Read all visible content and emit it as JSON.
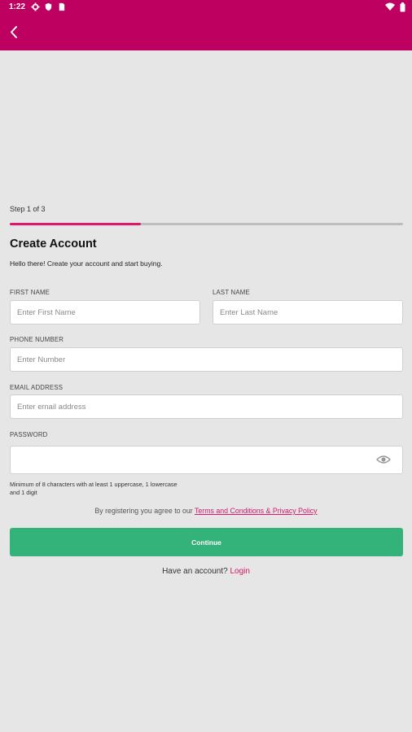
{
  "status_bar": {
    "time": "1:22",
    "icons": [
      "gear-icon",
      "shield-icon",
      "sim-card-icon",
      "wifi-icon",
      "battery-icon"
    ]
  },
  "app_bar": {
    "back_icon": "back-arrow-icon",
    "color": "#be0060"
  },
  "progress": {
    "step_label": "Step 1 of 3",
    "fraction": 0.333,
    "accent": "#e1156e"
  },
  "header": {
    "title": "Create Account",
    "subtitle": "Hello there! Create your account and start buying."
  },
  "form": {
    "first_name": {
      "label": "FIRST NAME",
      "placeholder": "Enter First Name",
      "value": ""
    },
    "last_name": {
      "label": "LAST NAME",
      "placeholder": "Enter Last Name",
      "value": ""
    },
    "phone": {
      "label": "PHONE NUMBER",
      "placeholder": "Enter Number",
      "value": ""
    },
    "email": {
      "label": "EMAIL ADDRESS",
      "placeholder": "Enter email address",
      "value": ""
    },
    "password": {
      "label": "PASSWORD",
      "placeholder": "",
      "value": "",
      "toggle_icon": "eye-icon"
    },
    "password_hint": "Minimum of 8 characters with at least 1 uppercase, 1 lowercase and 1 digit"
  },
  "terms": {
    "prefix": "By registering you agree to our",
    "link": "Terms and Conditions & Privacy Policy"
  },
  "continue_button": {
    "label": "Continue",
    "color": "#33b27a"
  },
  "login": {
    "prefix": "Have an account?",
    "link": "Login"
  }
}
